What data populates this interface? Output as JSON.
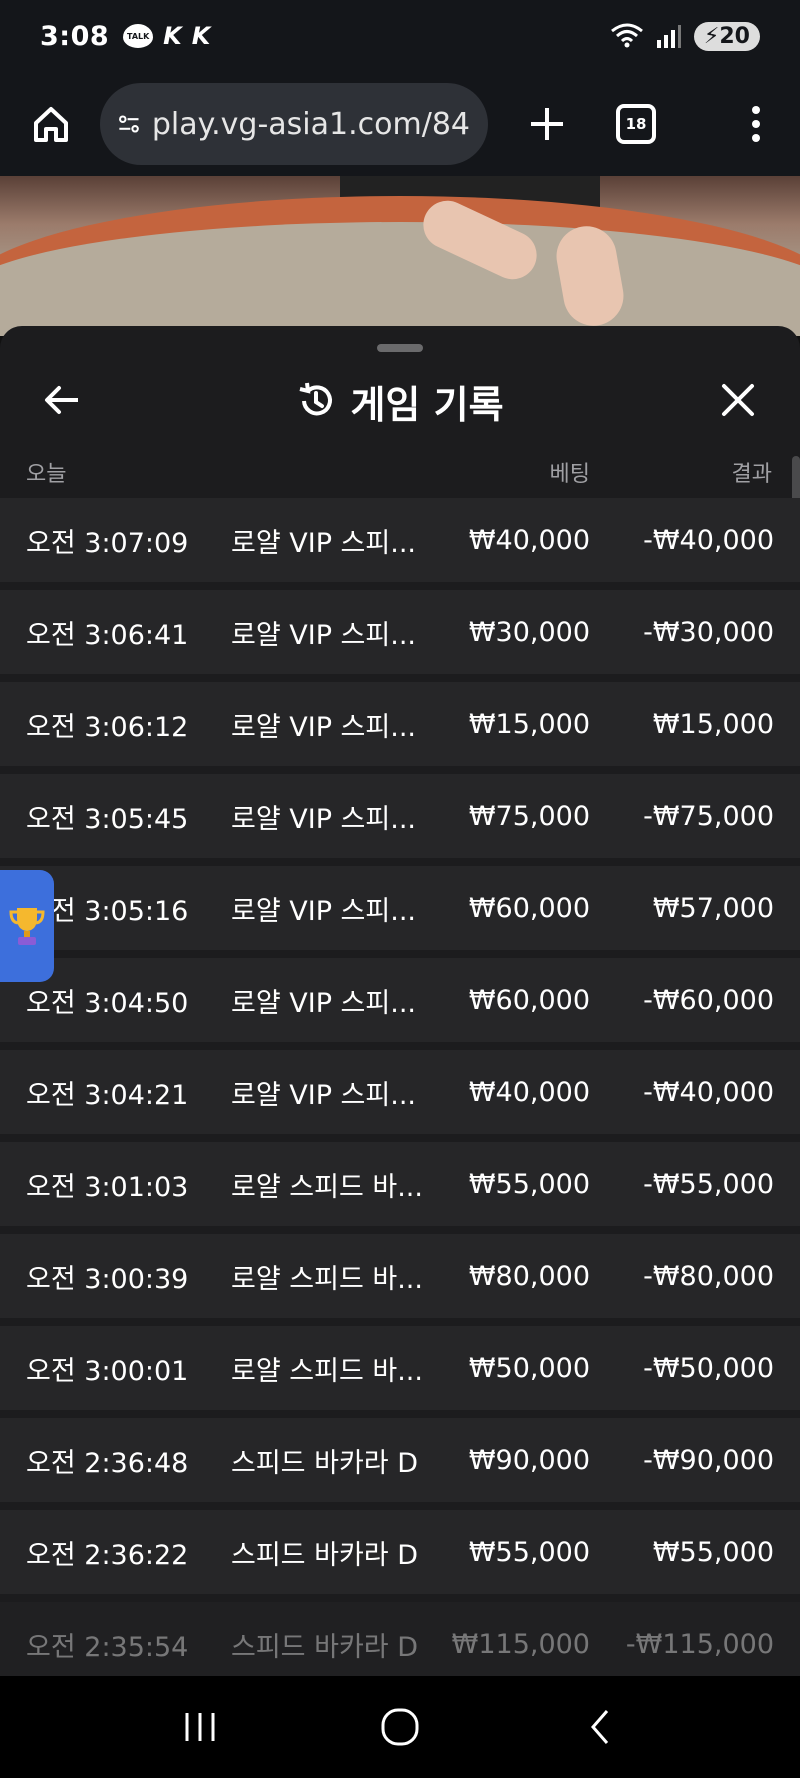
{
  "status": {
    "time": "3:08",
    "talk_label": "TALK",
    "k_icons": [
      "K",
      "K"
    ],
    "battery": "20"
  },
  "browser": {
    "url": "play.vg-asia1.com/84",
    "tab_count": "18"
  },
  "panel": {
    "title": "게임 기록",
    "columns": {
      "today": "오늘",
      "bet": "베팅",
      "result": "결과"
    },
    "rows": [
      {
        "time": "오전 3:07:09",
        "game": "로얄 VIP 스피...",
        "bet": "₩40,000",
        "result": "-₩40,000"
      },
      {
        "time": "오전 3:06:41",
        "game": "로얄 VIP 스피...",
        "bet": "₩30,000",
        "result": "-₩30,000"
      },
      {
        "time": "오전 3:06:12",
        "game": "로얄 VIP 스피...",
        "bet": "₩15,000",
        "result": "₩15,000"
      },
      {
        "time": "오전 3:05:45",
        "game": "로얄 VIP 스피...",
        "bet": "₩75,000",
        "result": "-₩75,000"
      },
      {
        "time": "오전 3:05:16",
        "game": "로얄 VIP 스피...",
        "bet": "₩60,000",
        "result": "₩57,000"
      },
      {
        "time": "오전 3:04:50",
        "game": "로얄 VIP 스피...",
        "bet": "₩60,000",
        "result": "-₩60,000"
      },
      {
        "time": "오전 3:04:21",
        "game": "로얄 VIP 스피...",
        "bet": "₩40,000",
        "result": "-₩40,000"
      },
      {
        "time": "오전 3:01:03",
        "game": "로얄 스피드 바...",
        "bet": "₩55,000",
        "result": "-₩55,000"
      },
      {
        "time": "오전 3:00:39",
        "game": "로얄 스피드 바...",
        "bet": "₩80,000",
        "result": "-₩80,000"
      },
      {
        "time": "오전 3:00:01",
        "game": "로얄 스피드 바...",
        "bet": "₩50,000",
        "result": "-₩50,000"
      },
      {
        "time": "오전 2:36:48",
        "game": "스피드 바카라 D",
        "bet": "₩90,000",
        "result": "-₩90,000"
      },
      {
        "time": "오전 2:36:22",
        "game": "스피드 바카라 D",
        "bet": "₩55,000",
        "result": "₩55,000"
      },
      {
        "time": "오전 2:35:54",
        "game": "스피드 바카라 D",
        "bet": "₩115,000",
        "result": "-₩115,000"
      }
    ]
  },
  "colors": {
    "panel_bg": "#1c1c1e",
    "row_bg": "#262628",
    "trophy_tab": "#3d6fdc"
  }
}
